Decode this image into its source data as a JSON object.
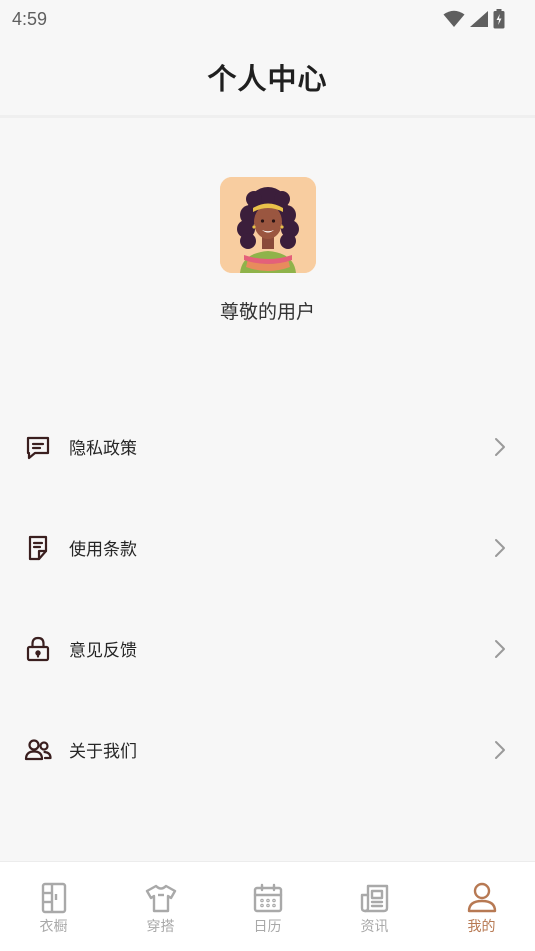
{
  "status_bar": {
    "time": "4:59"
  },
  "header": {
    "title": "个人中心"
  },
  "profile": {
    "username": "尊敬的用户"
  },
  "menu": {
    "items": [
      {
        "label": "隐私政策",
        "icon": "message-square-icon"
      },
      {
        "label": "使用条款",
        "icon": "document-icon"
      },
      {
        "label": "意见反馈",
        "icon": "lock-icon"
      },
      {
        "label": "关于我们",
        "icon": "users-icon"
      }
    ]
  },
  "tab_bar": {
    "tabs": [
      {
        "label": "衣橱",
        "icon": "wardrobe-icon",
        "active": false
      },
      {
        "label": "穿搭",
        "icon": "tshirt-icon",
        "active": false
      },
      {
        "label": "日历",
        "icon": "calendar-icon",
        "active": false
      },
      {
        "label": "资讯",
        "icon": "newspaper-icon",
        "active": false
      },
      {
        "label": "我的",
        "icon": "user-icon",
        "active": true
      }
    ]
  },
  "colors": {
    "accent": "#b77953",
    "icon_dark": "#3a1f1f",
    "inactive": "#a9a9a9",
    "background": "#f7f7f7"
  }
}
